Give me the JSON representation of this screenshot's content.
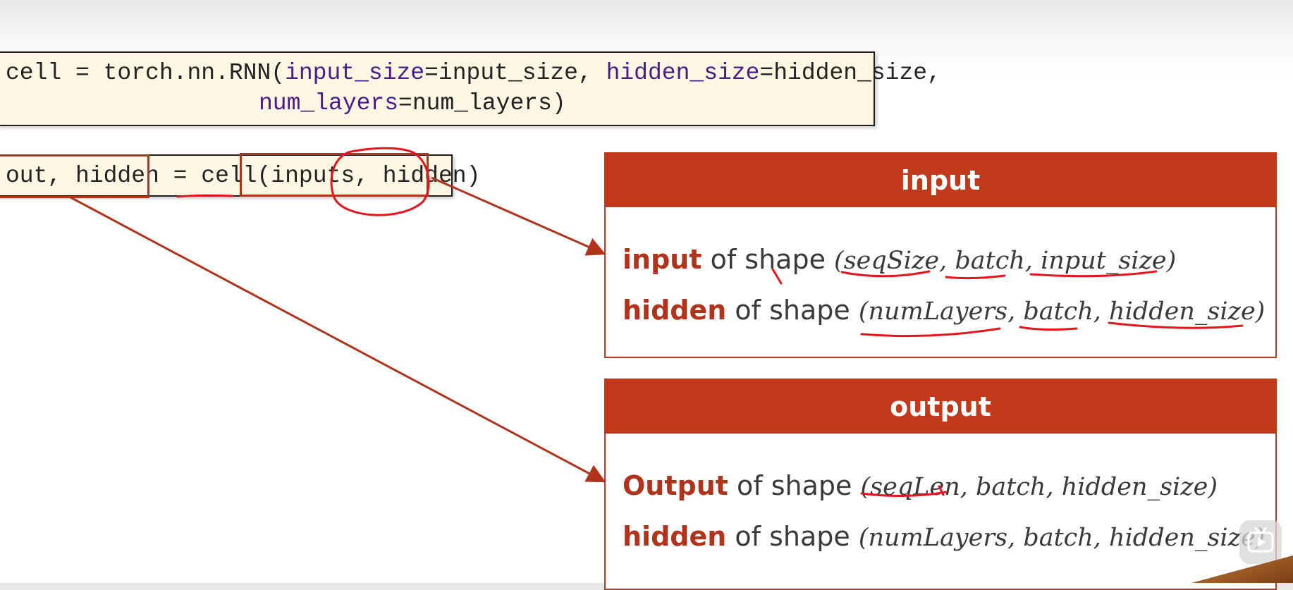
{
  "code_line_1": {
    "prefix": "cell = torch.nn.RNN(",
    "kw1": "input_size",
    "eq1": "=input_size, ",
    "kw2": "hidden_size",
    "eq2": "=hidden_size,"
  },
  "code_line_2": {
    "kw": "num_layers",
    "rest": "=num_layers)"
  },
  "code_call": {
    "outputs": "out, hidden",
    "eq": " = ",
    "fn": "cell",
    "open": "(",
    "arg1": "inputs, ",
    "arg2": "hidden",
    "close": ")"
  },
  "input_panel": {
    "title": "input",
    "rows": [
      {
        "keyword": "input",
        "text": " of shape ",
        "args": "(seqSize, batch, input_size)"
      },
      {
        "keyword": "hidden",
        "text": " of shape ",
        "args": "(numLayers, batch, hidden_size)"
      }
    ]
  },
  "output_panel": {
    "title": "output",
    "rows": [
      {
        "keyword": "Output",
        "text": " of shape ",
        "args": "(seqLen, batch, hidden_size)"
      },
      {
        "keyword": "hidden",
        "text": " of shape ",
        "args": "(numLayers, batch, hidden_size)"
      }
    ]
  },
  "colors": {
    "accent": "#c1391a",
    "code_bg": "#fdf6e3",
    "annotation": "#e8141c",
    "keyword": "#4b1a8c"
  }
}
